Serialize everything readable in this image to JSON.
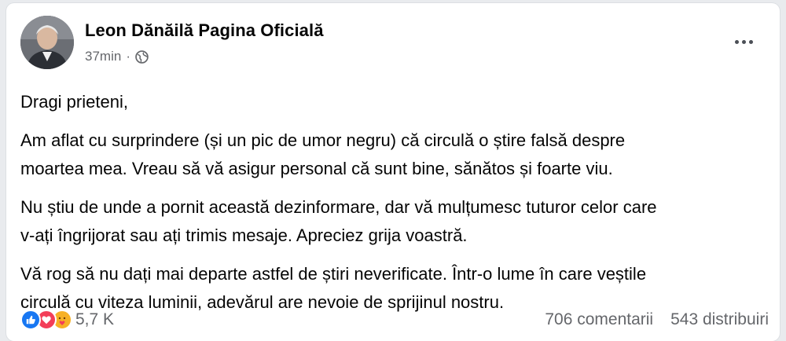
{
  "post": {
    "author": "Leon Dănăilă Pagina Oficială",
    "time": "37min",
    "separator": "·",
    "privacy_icon": "globe-icon",
    "more_icon": "more-dots-icon",
    "paragraphs": [
      "Dragi prieteni,",
      "Am aflat cu surprindere (și un pic de umor negru) că circulă o știre falsă despre\nmoartea mea. Vreau să vă asigur personal că sunt bine, sănătos și foarte viu.",
      "Nu știu de unde a pornit această dezinformare, dar vă mulțumesc tuturor celor care\nv-ați îngrijorat sau ați trimis mesaje. Apreciez grija voastră.",
      "Vă rog să nu dați mai departe astfel de știri neverificate. Într-o lume în care veștile\ncirculă cu viteza luminii, adevărul are nevoie de sprijinul nostru."
    ]
  },
  "footer": {
    "reaction_icons": [
      "like-icon",
      "love-icon",
      "care-icon"
    ],
    "reaction_count": "5,7 K",
    "comments": "706 comentarii",
    "shares": "543 distribuiri"
  },
  "colors": {
    "like": "#1877f2",
    "love": "#f33e58",
    "care": "#f7b125",
    "secondary_text": "#65676b"
  }
}
